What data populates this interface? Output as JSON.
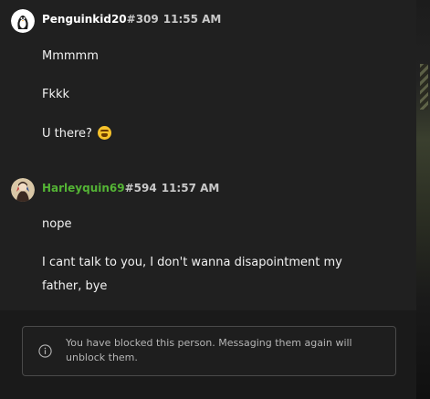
{
  "messages": [
    {
      "username": "Penguinkid20",
      "tag": "#309",
      "time": "11:55 AM",
      "avatar_icon": "penguin-avatar",
      "username_color": "#ffffff",
      "lines": [
        "Mmmmm",
        "Fkkk",
        "U there?"
      ],
      "emoji": "tired-face-emoji"
    },
    {
      "username": "Harleyquin69",
      "tag": "#594",
      "time": "11:57 AM",
      "avatar_icon": "harley-quinn-avatar",
      "username_color": "#54b435",
      "lines": [
        "nope",
        "I cant talk to you, I don't wanna disapointment my father, bye"
      ]
    }
  ],
  "notice": {
    "icon": "info-icon",
    "text": "You have blocked this person. Messaging them again will unblock them."
  }
}
